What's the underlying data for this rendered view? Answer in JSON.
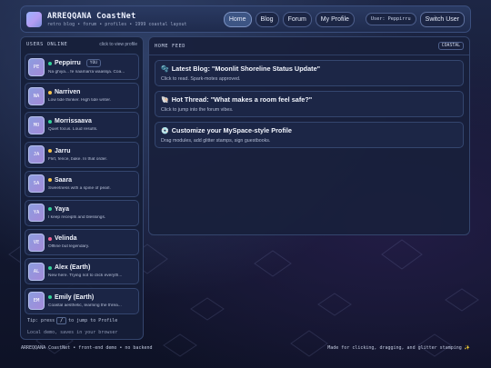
{
  "header": {
    "title": "ARREQQANA CoastNet",
    "subtitle": "retro blog • forum • profiles • 1999 coastal layout",
    "nav": [
      {
        "label": "Home",
        "active": true
      },
      {
        "label": "Blog",
        "active": false
      },
      {
        "label": "Forum",
        "active": false
      },
      {
        "label": "My Profile",
        "active": false
      }
    ],
    "user_pill": "User: Peppirru",
    "switch_label": "Switch User"
  },
  "sidebar": {
    "title": "USERS ONLINE",
    "hint": "click to view profile",
    "users": [
      {
        "initials": "PE",
        "name": "Peppirru",
        "you": "YOU",
        "status": "Na ghiya... fe naamarra waassja. Coa...",
        "dot": "#34d399"
      },
      {
        "initials": "NA",
        "name": "Narriven",
        "you": "",
        "status": "Low tide thinker. High tide writer.",
        "dot": "#f5c44d"
      },
      {
        "initials": "MO",
        "name": "Morrissaava",
        "you": "",
        "status": "Quiet focus. Loud results.",
        "dot": "#34d399"
      },
      {
        "initials": "JA",
        "name": "Jarru",
        "you": "",
        "status": "Flirt, fence, bake. In that order.",
        "dot": "#f5c44d"
      },
      {
        "initials": "SA",
        "name": "Saara",
        "you": "",
        "status": "Sweetness with a spine of pearl.",
        "dot": "#f5c44d"
      },
      {
        "initials": "YA",
        "name": "Yaya",
        "you": "",
        "status": "I keep receipts and blessings.",
        "dot": "#34d399"
      },
      {
        "initials": "VE",
        "name": "Velinda",
        "you": "",
        "status": "Offline but legendary.",
        "dot": "#f06292"
      },
      {
        "initials": "AL",
        "name": "Alex (Earth)",
        "you": "",
        "status": "New here. Trying not to click everyth...",
        "dot": "#34d399"
      },
      {
        "initials": "EM",
        "name": "Emily (Earth)",
        "you": "",
        "status": "Coastal aesthetic, learning the threa...",
        "dot": "#34d399"
      }
    ],
    "tip_prefix": "Tip: press",
    "tip_key": "/",
    "tip_suffix": "to jump to Profile",
    "local_note": "Local demo, saves in your browser"
  },
  "main": {
    "title": "HOME FEED",
    "badge": "COASTAL",
    "cards": [
      {
        "icon": "🫧",
        "icon_name": "bubbles-icon",
        "title": "Latest Blog: \"Moonlit Shoreline Status Update\"",
        "sub": "Click to read. Spark-motes approved."
      },
      {
        "icon": "🐚",
        "icon_name": "shell-icon",
        "title": "Hot Thread: \"What makes a room feel safe?\"",
        "sub": "Click to jump into the forum vibes."
      },
      {
        "icon": "💿",
        "icon_name": "disc-icon",
        "title": "Customize your MySpace-style Profile",
        "sub": "Drag modules, add glitter stamps, sign guestbooks."
      }
    ]
  },
  "footer": {
    "left": "ARREQQANA CoastNet • front-end demo • no backend",
    "right": "Made for clicking, dragging, and glitter stamping ✨"
  }
}
